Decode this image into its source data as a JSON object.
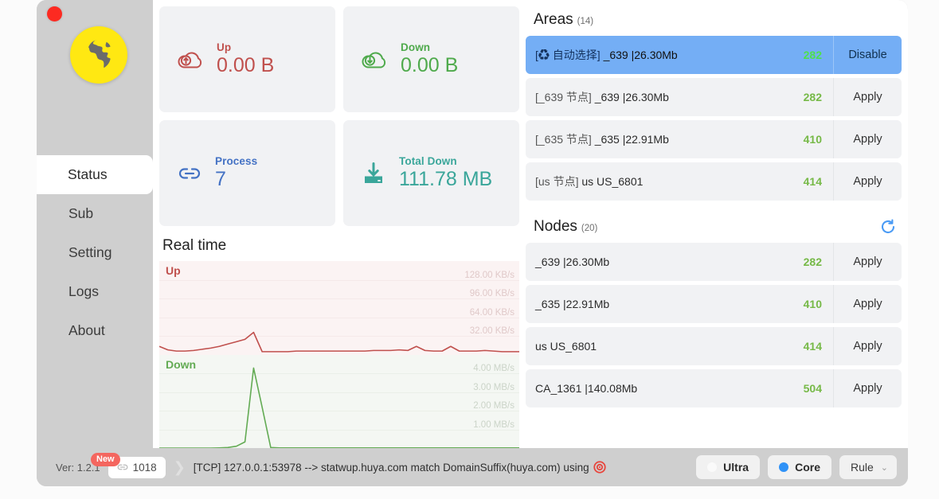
{
  "window": {
    "close_button": "close-dot",
    "logo": "globe-logo"
  },
  "sidebar": {
    "items": [
      {
        "label": "Status",
        "active": true
      },
      {
        "label": "Sub",
        "active": false
      },
      {
        "label": "Setting",
        "active": false
      },
      {
        "label": "Logs",
        "active": false
      },
      {
        "label": "About",
        "active": false
      }
    ]
  },
  "stats": [
    {
      "icon": "cloud-up-icon",
      "label": "Up",
      "value": "0.00 B",
      "color": "#c0504d"
    },
    {
      "icon": "cloud-down-icon",
      "label": "Down",
      "value": "0.00 B",
      "color": "#4faa4c"
    },
    {
      "icon": "link-icon",
      "label": "Process",
      "value": "7",
      "color": "#4472c4"
    },
    {
      "icon": "download-tray-icon",
      "label": "Total Down",
      "value": "111.78 MB",
      "color": "#3aa69a"
    }
  ],
  "realtime": {
    "title": "Real time"
  },
  "chart_data": [
    {
      "type": "line",
      "title": "Up",
      "series": [
        {
          "name": "Up",
          "color": "#c0504d",
          "values": [
            14,
            8,
            6,
            6,
            7,
            9,
            11,
            14,
            18,
            22,
            26,
            38,
            5,
            5,
            5,
            5,
            6,
            6,
            6,
            6,
            6,
            6,
            6,
            6,
            6,
            7,
            7,
            7,
            8,
            7,
            14,
            7,
            6,
            6,
            14,
            6,
            6,
            6,
            7,
            6,
            5,
            5,
            5
          ]
        }
      ],
      "ylabel": "KB/s",
      "ylim": [
        0,
        160
      ],
      "yticks": [
        128,
        96,
        64,
        32
      ],
      "ytick_labels": [
        "128.00 KB/s",
        "96.00 KB/s",
        "64.00 KB/s",
        "32.00 KB/s"
      ],
      "grid": true,
      "legend": "top-left"
    },
    {
      "type": "line",
      "title": "Down",
      "series": [
        {
          "name": "Down",
          "color": "#63ab54",
          "values": [
            0.02,
            0.02,
            0.02,
            0.02,
            0.02,
            0.02,
            0.02,
            0.03,
            0.05,
            0.12,
            0.35,
            4.3,
            2.2,
            0.05,
            0.03,
            0.03,
            0.03,
            0.03,
            0.03,
            0.03,
            0.03,
            0.03,
            0.03,
            0.03,
            0.03,
            0.03,
            0.03,
            0.03,
            0.03,
            0.03,
            0.03,
            0.03,
            0.03,
            0.03,
            0.03,
            0.03,
            0.03,
            0.03,
            0.03,
            0.03,
            0.03,
            0.03,
            0.03
          ]
        }
      ],
      "ylabel": "MB/s",
      "ylim": [
        0,
        5
      ],
      "yticks": [
        4,
        3,
        2,
        1
      ],
      "ytick_labels": [
        "4.00 MB/s",
        "3.00 MB/s",
        "2.00 MB/s",
        "1.00 MB/s"
      ],
      "grid": true,
      "legend": "top-left"
    }
  ],
  "areas": {
    "title": "Areas",
    "count": "(14)",
    "rows": [
      {
        "prefix": "[♻ 自动选择]",
        "name": "_639 |26.30Mb",
        "delay": "282",
        "action": "Disable",
        "selected": true
      },
      {
        "prefix": "[_639 节点]",
        "name": "_639 |26.30Mb",
        "delay": "282",
        "action": "Apply",
        "selected": false
      },
      {
        "prefix": "[_635 节点]",
        "name": "_635 |22.91Mb",
        "delay": "410",
        "action": "Apply",
        "selected": false
      },
      {
        "prefix": "[us 节点]",
        "name": "us US_6801",
        "delay": "414",
        "action": "Apply",
        "selected": false
      }
    ]
  },
  "nodes": {
    "title": "Nodes",
    "count": "(20)",
    "refresh_icon": "refresh-icon",
    "rows": [
      {
        "prefix": "",
        "name": "_639 |26.30Mb",
        "delay": "282",
        "action": "Apply",
        "selected": false
      },
      {
        "prefix": "",
        "name": "_635 |22.91Mb",
        "delay": "410",
        "action": "Apply",
        "selected": false
      },
      {
        "prefix": "",
        "name": "us US_6801",
        "delay": "414",
        "action": "Apply",
        "selected": false
      },
      {
        "prefix": "",
        "name": "CA_1361 |140.08Mb",
        "delay": "504",
        "action": "Apply",
        "selected": false
      }
    ]
  },
  "statusbar": {
    "version": "Ver: 1.2.1",
    "new_badge": "New",
    "connections": "1018",
    "connections_icon": "link-small-icon",
    "chevron": "❯",
    "log": "[TCP] 127.0.0.1:53978 --> statwup.huya.com match DomainSuffix(huya.com) using",
    "target_icon": "target-icon",
    "ultra": {
      "label": "Ultra",
      "active": false
    },
    "core": {
      "label": "Core",
      "active": true
    },
    "rule": {
      "label": "Rule",
      "caret": "⌄"
    }
  },
  "colors": {
    "accent_blue": "#2f92f7",
    "selected_row": "#74aef5",
    "delay_green": "#76b947",
    "up_red": "#c0504d",
    "down_green": "#63ab54",
    "sidebar_gray": "#cfcfcf",
    "card_gray": "#f1f2f4"
  }
}
